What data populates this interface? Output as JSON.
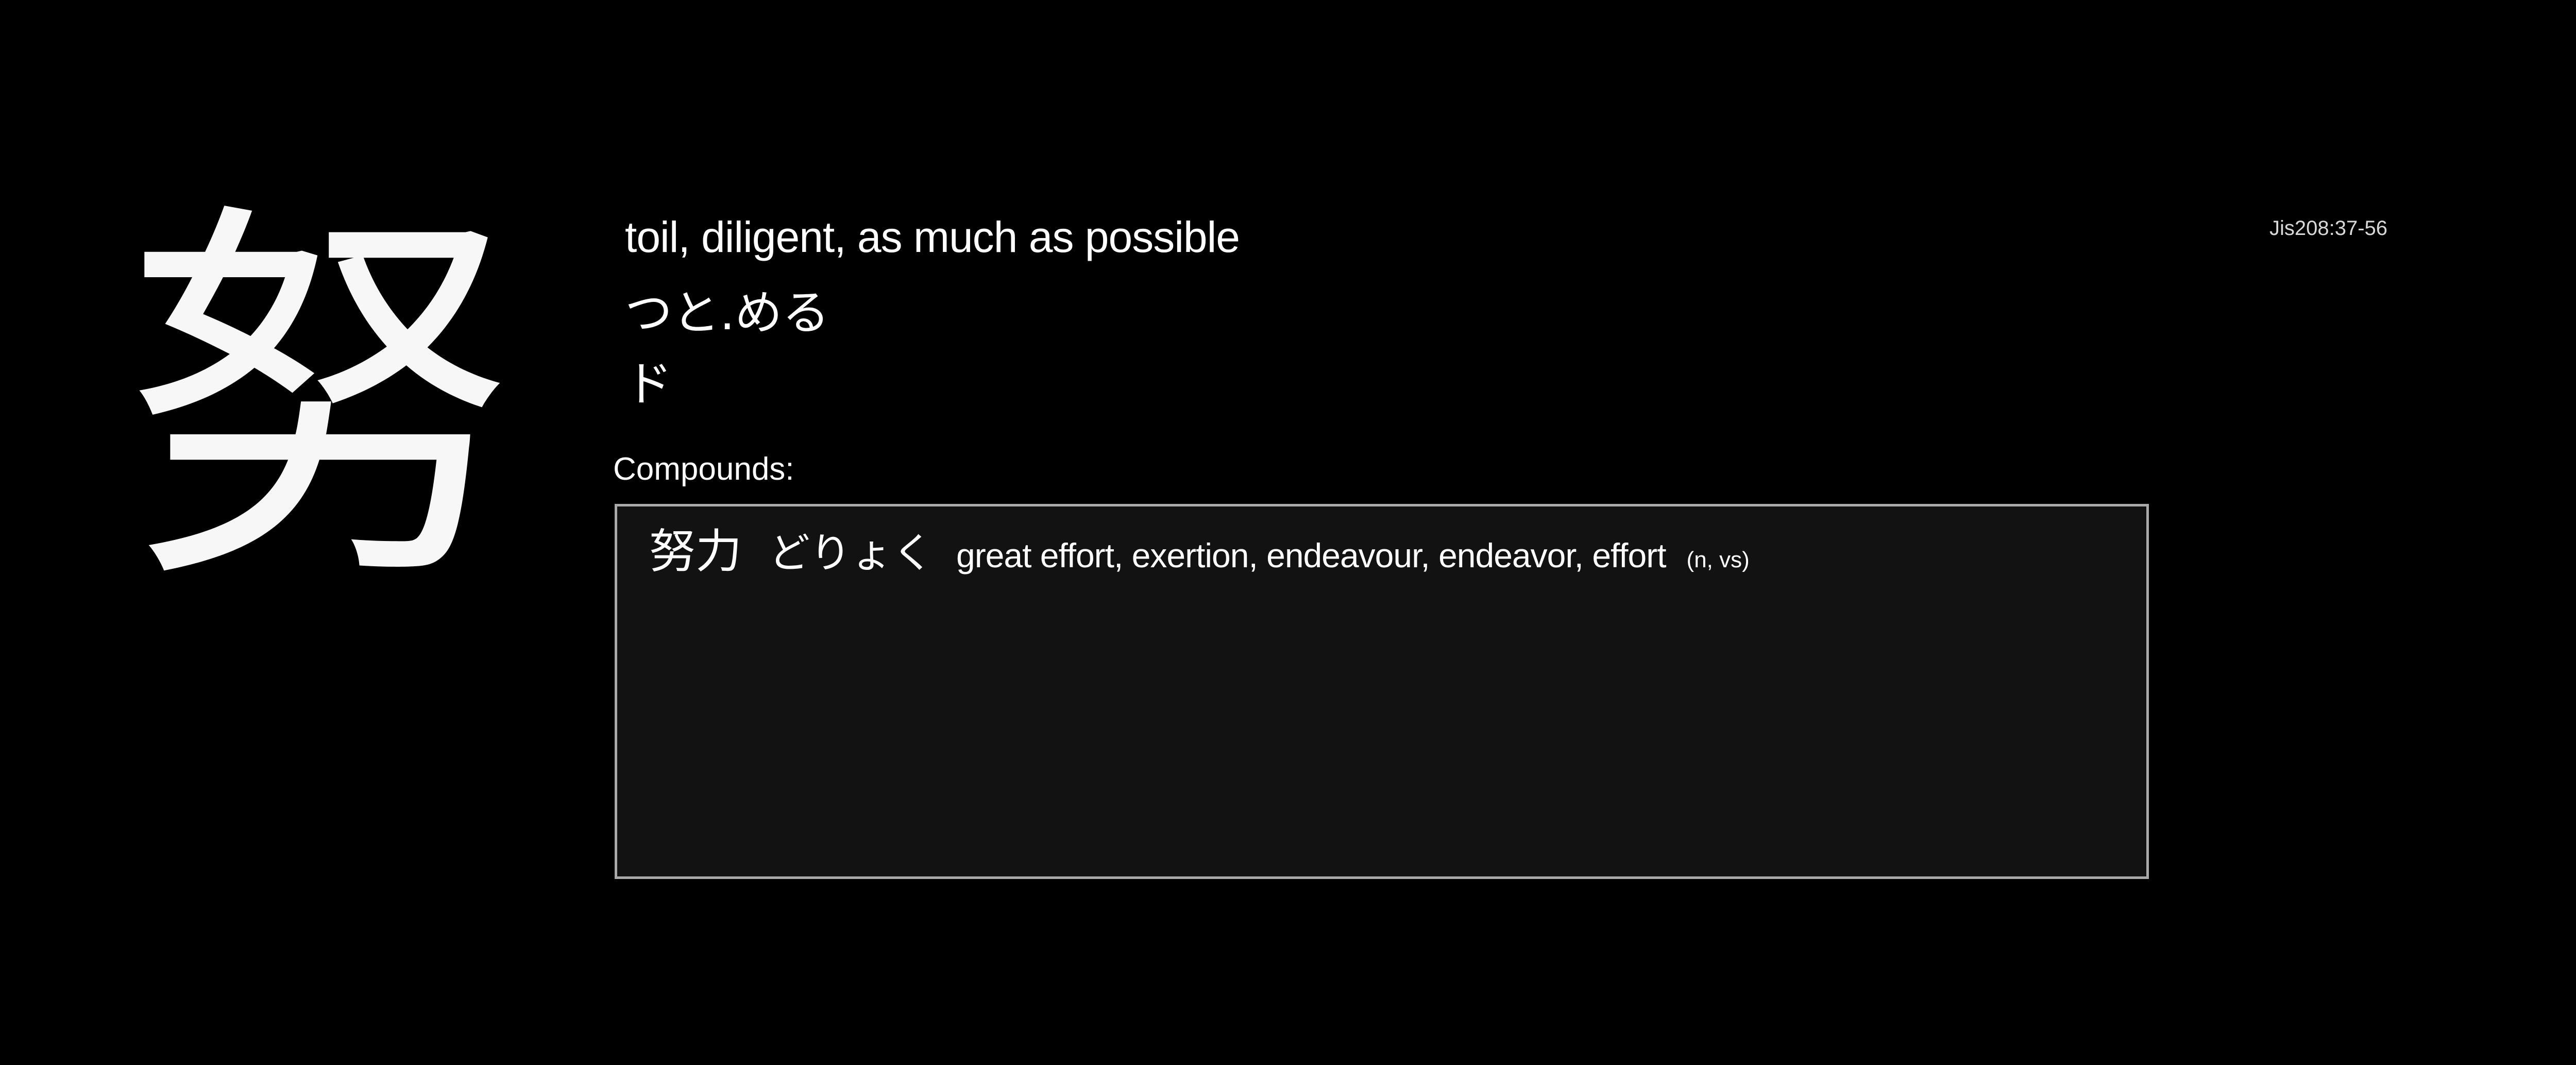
{
  "kanji": {
    "character": "努",
    "meaning": "toil, diligent, as much as possible",
    "kun_reading": "つと.める",
    "on_reading": "ド",
    "jis_code": "Jis208:37-56"
  },
  "compounds": {
    "label": "Compounds:",
    "items": [
      {
        "word": "努力",
        "reading": "どりょく",
        "gloss": "great effort, exertion, endeavour, endeavor, effort",
        "pos": "(n, vs)"
      }
    ]
  },
  "colors": {
    "background": "#000000",
    "text": "#ffffff",
    "box_background": "#121212",
    "box_border": "#a9a9a9"
  }
}
